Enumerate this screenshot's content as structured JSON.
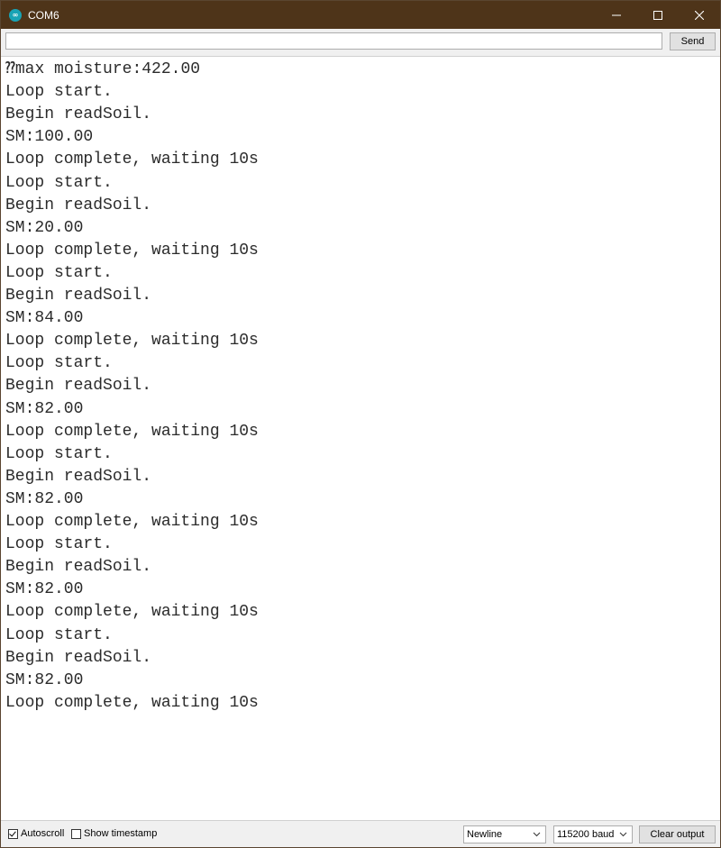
{
  "window": {
    "title": "COM6",
    "icon": "arduino-icon",
    "icon_glyph": "∞",
    "controls": [
      "minimize-icon",
      "maximize-icon",
      "close-icon"
    ]
  },
  "toolbar": {
    "input_value": "",
    "input_placeholder": "",
    "send_label": "Send"
  },
  "output": {
    "lines": [
      "⁇max moisture:422.00",
      "Loop start.",
      "Begin readSoil.",
      "SM:100.00",
      "Loop complete, waiting 10s",
      "Loop start.",
      "Begin readSoil.",
      "SM:20.00",
      "Loop complete, waiting 10s",
      "Loop start.",
      "Begin readSoil.",
      "SM:84.00",
      "Loop complete, waiting 10s",
      "Loop start.",
      "Begin readSoil.",
      "SM:82.00",
      "Loop complete, waiting 10s",
      "Loop start.",
      "Begin readSoil.",
      "SM:82.00",
      "Loop complete, waiting 10s",
      "Loop start.",
      "Begin readSoil.",
      "SM:82.00",
      "Loop complete, waiting 10s",
      "Loop start.",
      "Begin readSoil.",
      "SM:82.00",
      "Loop complete, waiting 10s"
    ]
  },
  "statusbar": {
    "autoscroll_label": "Autoscroll",
    "autoscroll_checked": true,
    "timestamp_label": "Show timestamp",
    "timestamp_checked": false,
    "line_ending": "Newline",
    "baud_rate": "115200 baud",
    "clear_label": "Clear output"
  },
  "colors": {
    "titlebar": "#4e3419",
    "app_icon": "#19a3b5",
    "output_text": "#2b2b2b"
  }
}
